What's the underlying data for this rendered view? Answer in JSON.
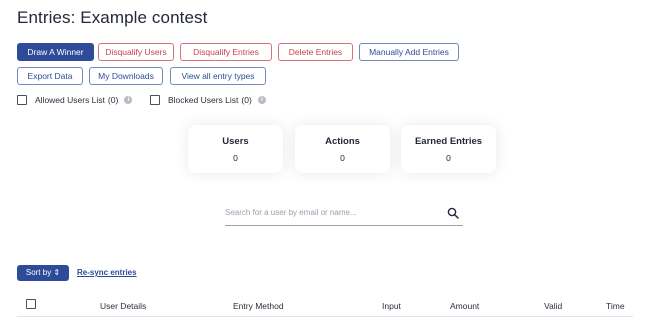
{
  "page": {
    "title": "Entries: Example contest"
  },
  "toolbar": {
    "draw_winner": "Draw A Winner",
    "disqualify_users": "Disqualify Users",
    "disqualify_entries": "Disqualify Entries",
    "delete_entries": "Delete Entries",
    "manually_add": "Manually Add Entries",
    "export_data": "Export Data",
    "my_downloads": "My Downloads",
    "view_entry_types": "View all entry types"
  },
  "filters": {
    "allowed_label": "Allowed Users List",
    "allowed_count": "(0)",
    "blocked_label": "Blocked Users List",
    "blocked_count": "(0)"
  },
  "stats": [
    {
      "label": "Users",
      "value": "0"
    },
    {
      "label": "Actions",
      "value": "0"
    },
    {
      "label": "Earned Entries",
      "value": "0"
    }
  ],
  "search": {
    "placeholder": "Search for a user by email or name...",
    "icon": "search-icon"
  },
  "controls": {
    "sort_by": "Sort by ⇕",
    "resync": "Re-sync entries"
  },
  "table": {
    "columns": [
      "User Details",
      "Entry Method",
      "Input",
      "Amount",
      "Valid",
      "Time"
    ]
  },
  "colors": {
    "primary": "#2e4b9a",
    "danger": "#c8414a"
  }
}
